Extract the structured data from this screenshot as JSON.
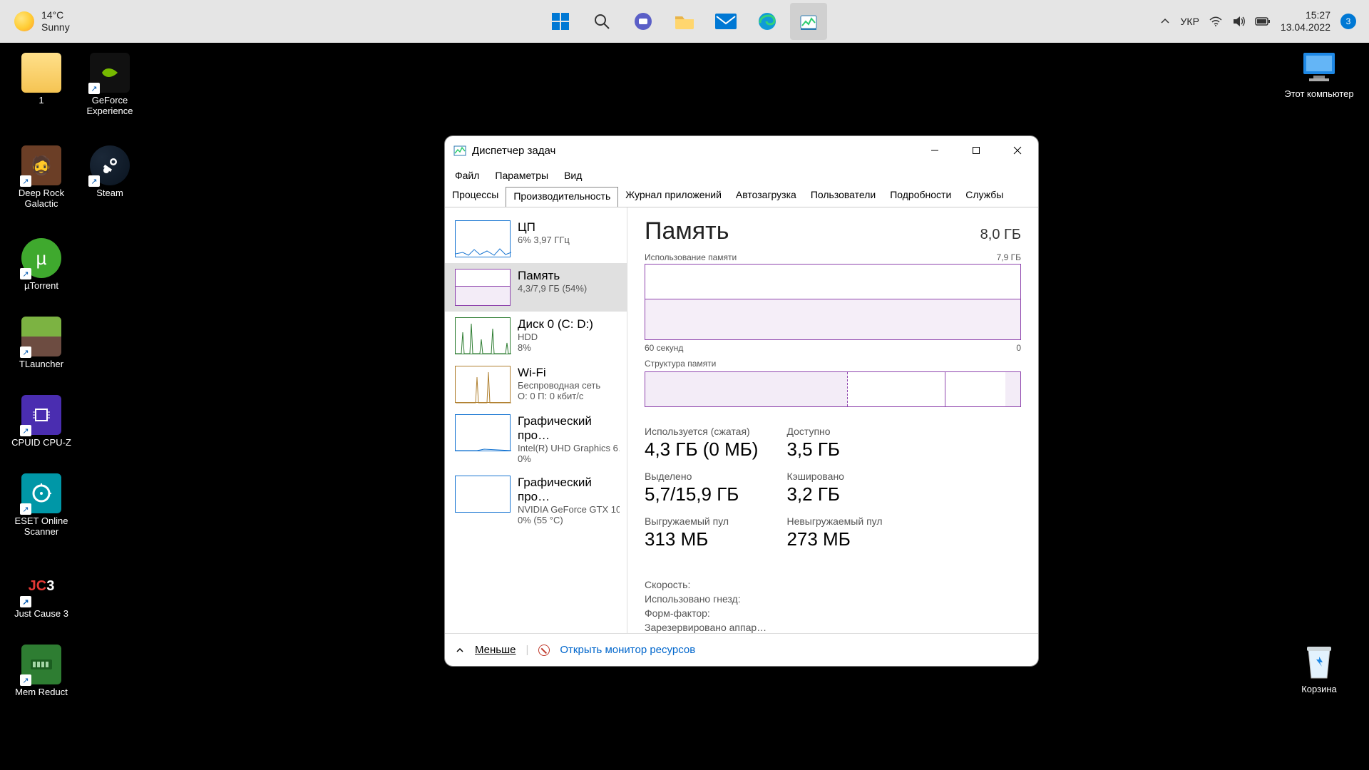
{
  "taskbar": {
    "weather": {
      "temp": "14°C",
      "cond": "Sunny"
    },
    "lang": "УКР",
    "time": "15:27",
    "date": "13.04.2022",
    "notifications": "3"
  },
  "desktop": {
    "left": [
      [
        {
          "name": "1",
          "kind": "folder"
        },
        {
          "name": "GeForce Experience",
          "kind": "nvidia",
          "shortcut": true
        }
      ],
      [
        {
          "name": "Deep Rock Galactic",
          "kind": "drg",
          "shortcut": true
        },
        {
          "name": "Steam",
          "kind": "steam",
          "shortcut": true
        }
      ],
      [
        {
          "name": "µTorrent",
          "kind": "utorrent",
          "shortcut": true
        }
      ],
      [
        {
          "name": "TLauncher",
          "kind": "minecraft",
          "shortcut": true
        }
      ],
      [
        {
          "name": "CPUID CPU-Z",
          "kind": "cpuz",
          "shortcut": true
        }
      ],
      [
        {
          "name": "ESET Online Scanner",
          "kind": "eset",
          "shortcut": true
        }
      ],
      [
        {
          "name": "Just Cause 3",
          "kind": "jc3",
          "shortcut": true
        }
      ],
      [
        {
          "name": "Mem Reduct",
          "kind": "memreduct",
          "shortcut": true
        }
      ]
    ],
    "right_top": "Этот компьютер",
    "right_bottom": "Корзина"
  },
  "tm": {
    "title": "Диспетчер задач",
    "menu": {
      "file": "Файл",
      "options": "Параметры",
      "view": "Вид"
    },
    "tabs": {
      "processes": "Процессы",
      "performance": "Производительность",
      "apphistory": "Журнал приложений",
      "startup": "Автозагрузка",
      "users": "Пользователи",
      "details": "Подробности",
      "services": "Службы"
    },
    "sidebar": {
      "cpu": {
        "title": "ЦП",
        "sub": "6%  3,97 ГГц"
      },
      "mem": {
        "title": "Память",
        "sub": "4,3/7,9 ГБ (54%)"
      },
      "disk": {
        "title": "Диск 0 (C: D:)",
        "sub1": "HDD",
        "sub2": "8%"
      },
      "wifi": {
        "title": "Wi-Fi",
        "sub1": "Беспроводная сеть",
        "sub2": "О: 0  П: 0 кбит/с"
      },
      "gpu0": {
        "title": "Графический про…",
        "sub1": "Intel(R) UHD Graphics 6…",
        "sub2": "0%"
      },
      "gpu1": {
        "title": "Графический про…",
        "sub1": "NVIDIA GeForce GTX 10…",
        "sub2": "0% (55 °C)"
      }
    },
    "main": {
      "heading": "Память",
      "total": "8,0 ГБ",
      "usage_label": "Использование памяти",
      "usage_max": "7,9 ГБ",
      "xaxis_left": "60 секунд",
      "xaxis_right": "0",
      "comp_label": "Структура памяти",
      "stats": {
        "in_use_label": "Используется (сжатая)",
        "in_use": "4,3 ГБ (0 МБ)",
        "avail_label": "Доступно",
        "avail": "3,5 ГБ",
        "committed_label": "Выделено",
        "committed": "5,7/15,9 ГБ",
        "cached_label": "Кэшировано",
        "cached": "3,2 ГБ",
        "paged_label": "Выгружаемый пул",
        "paged": "313 МБ",
        "nonpaged_label": "Невыгружаемый пул",
        "nonpaged": "273 МБ"
      },
      "meta": {
        "speed": "Скорость:",
        "slots": "Использовано гнезд:",
        "form": "Форм-фактор:",
        "reserved": "Зарезервировано аппар…"
      }
    },
    "footer": {
      "fewer": "Меньше",
      "resmon": "Открыть монитор ресурсов"
    }
  },
  "chart_data": {
    "type": "line",
    "title": "Использование памяти",
    "xlabel": "секунд",
    "ylabel": "ГБ",
    "x_range": [
      60,
      0
    ],
    "ylim": [
      0,
      7.9
    ],
    "x": [
      60,
      55,
      50,
      45,
      40,
      35,
      30,
      25,
      20,
      15,
      10,
      5,
      0
    ],
    "values": [
      4.3,
      4.3,
      4.3,
      4.3,
      4.3,
      4.3,
      4.3,
      4.3,
      4.3,
      4.3,
      4.3,
      4.3,
      4.3
    ],
    "series": [
      {
        "name": "Память",
        "values": [
          4.3,
          4.3,
          4.3,
          4.3,
          4.3,
          4.3,
          4.3,
          4.3,
          4.3,
          4.3,
          4.3,
          4.3,
          4.3
        ]
      }
    ]
  }
}
